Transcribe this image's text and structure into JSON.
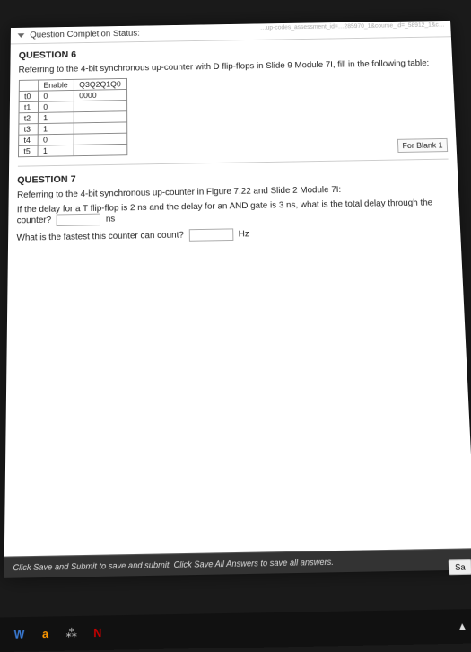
{
  "status": {
    "label": "Question Completion Status:"
  },
  "url_faint": "…up-codes_assessment_id=…285970_1&course_id=_58912_1&c…",
  "q6": {
    "title": "QUESTION 6",
    "text": "Referring to the 4-bit synchronous up-counter with D flip-flops in Slide 9 Module 7I, fill in the following table:",
    "headers": [
      "",
      "Enable",
      "Q3Q2Q1Q0"
    ],
    "rows": [
      [
        "t0",
        "0",
        "0000"
      ],
      [
        "t1",
        "0",
        ""
      ],
      [
        "t2",
        "1",
        ""
      ],
      [
        "t3",
        "1",
        ""
      ],
      [
        "t4",
        "0",
        ""
      ],
      [
        "t5",
        "1",
        ""
      ]
    ],
    "forblank": "For Blank 1"
  },
  "q7": {
    "title": "QUESTION 7",
    "line1": "Referring to the 4-bit synchronous up-counter in Figure 7.22 and Slide 2 Module 7I:",
    "line2a": "If the delay for a T flip-flop is 2 ns and the delay for an AND gate is 3 ns, what is the total delay through the counter?",
    "line2_unit": "ns",
    "line3a": "What is the fastest this counter can count?",
    "line3_unit": "Hz"
  },
  "footer": {
    "text": "Click Save and Submit to save and submit. Click Save All Answers to save all answers."
  },
  "right_btn": "Sa",
  "taskbar_icons": {
    "word": "W",
    "amazon": "a",
    "more": "⁂",
    "n": "N",
    "up": "▲"
  }
}
